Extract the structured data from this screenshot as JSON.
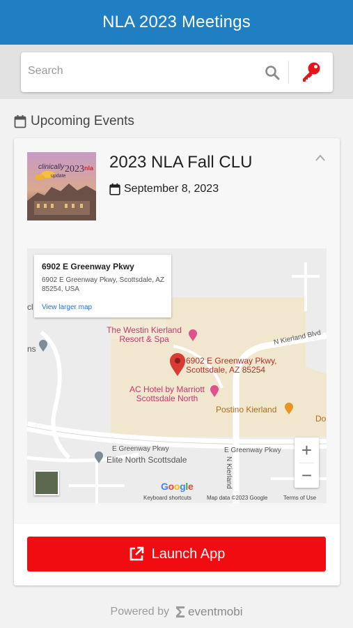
{
  "header": {
    "title": "NLA 2023 Meetings"
  },
  "search": {
    "placeholder": "Search"
  },
  "section": {
    "title": "Upcoming Events"
  },
  "event": {
    "title": "2023 NLA Fall CLU",
    "date": "September 8, 2023",
    "thumbnail_text": "clinically update 2023"
  },
  "map": {
    "info_address_title": "6902 E Greenway Pkwy",
    "info_address_full": "6902 E Greenway Pkwy, Scottsdale, AZ 85254, USA",
    "info_link": "View larger map",
    "places": {
      "westin": "The Westin Kierland Resort & Spa",
      "marker_address": "6902 E Greenway Pkwy, Scottsdale, AZ 85254",
      "ac_hotel": "AC Hotel by Marriott Scottsdale North",
      "postino": "Postino Kierland",
      "elite": "Elite North Scottsdale",
      "do_partial": "Do",
      "ns_partial": "ns",
      "cl_partial": "cl"
    },
    "streets": {
      "greenway_left": "E Greenway Pkwy",
      "greenway_right": "E Greenway Pkwy",
      "kierland_blvd": "N Kierland Blvd",
      "n_kierland": "N Kierland"
    },
    "google": "Google",
    "footer": {
      "shortcuts": "Keyboard shortcuts",
      "mapdata": "Map data ©2023 Google",
      "terms": "Terms of Use"
    },
    "zoom_in": "+",
    "zoom_out": "−"
  },
  "launch": {
    "label": "Launch App"
  },
  "footer": {
    "powered_by": "Powered by",
    "brand": "eventmobi"
  },
  "colors": {
    "header_bg": "#1f7fc2",
    "launch_bg": "#f10c12",
    "key_icon": "#e8141b",
    "map_pink": "#c8356e",
    "map_brown": "#b06a1d"
  },
  "icons": {
    "search": "search-icon",
    "key": "key-icon",
    "calendar": "calendar-icon",
    "chevron": "chevron-up-icon",
    "external_link": "external-link-icon",
    "map_pin": "map-pin-icon"
  }
}
